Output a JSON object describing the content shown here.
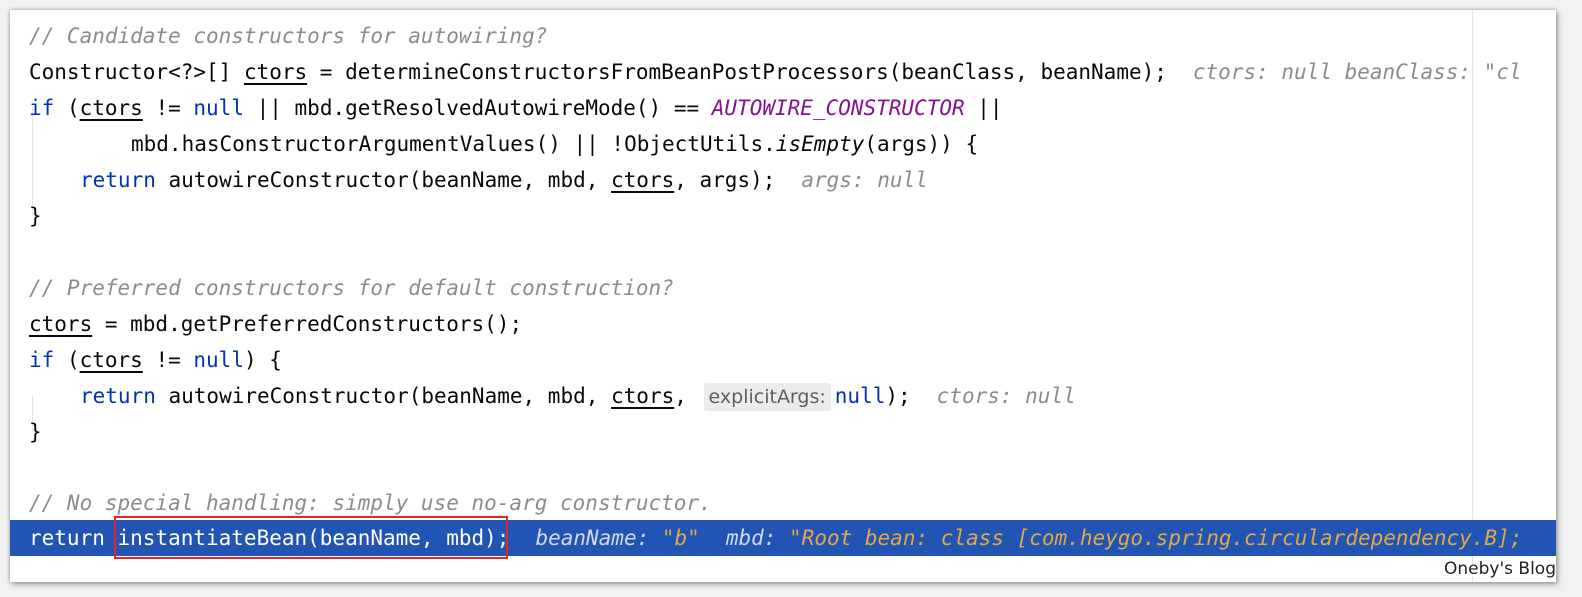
{
  "editor": {
    "lines": {
      "l1": "// Candidate constructors for autowiring?",
      "l2a": "Constructor<?>[] ",
      "l2b": "ctors",
      "l2c": " = determineConstructorsFromBeanPostProcessors(beanClass, beanName);",
      "l2hint": "ctors: null  beanClass: \"cl",
      "l3kw": "if",
      "l3a": " (",
      "l3b": "ctors",
      "l3c": " != ",
      "l3null": "null",
      "l3d": " || mbd.getResolvedAutowireMode() == ",
      "l3const": "AUTOWIRE_CONSTRUCTOR",
      "l3e": " ||",
      "l4a": "mbd.hasConstructorArgumentValues() || !ObjectUtils.",
      "l4it": "isEmpty",
      "l4b": "(args)) {",
      "l5kw": "return",
      "l5a": " autowireConstructor(beanName, mbd, ",
      "l5b": "ctors",
      "l5c": ", args);",
      "l5hint": "args: null",
      "l6": "}",
      "l8": "// Preferred constructors for default construction?",
      "l9a": "ctors",
      "l9b": " = mbd.getPreferredConstructors();",
      "l10kw": "if",
      "l10a": " (",
      "l10b": "ctors",
      "l10c": " != ",
      "l10null": "null",
      "l10d": ") {",
      "l11kw": "return",
      "l11a": " autowireConstructor(beanName, mbd, ",
      "l11b": "ctors",
      "l11c": ",",
      "l11param": "explicitArgs:",
      "l11null": "null",
      "l11d": ");",
      "l11hint": "ctors: null",
      "l12": "}",
      "l14": "// No special handling: simply use no-arg constructor.",
      "l15kw": "return",
      "l15a": " instantiateBean(beanName, mbd);",
      "l15h1": "beanName:",
      "l15v1": " \"b\"",
      "l15h2": "mbd:",
      "l15v2": " \"Root bean: class [com.heygo.spring.circulardependency.B];"
    }
  },
  "watermark": "Oneby's Blog"
}
